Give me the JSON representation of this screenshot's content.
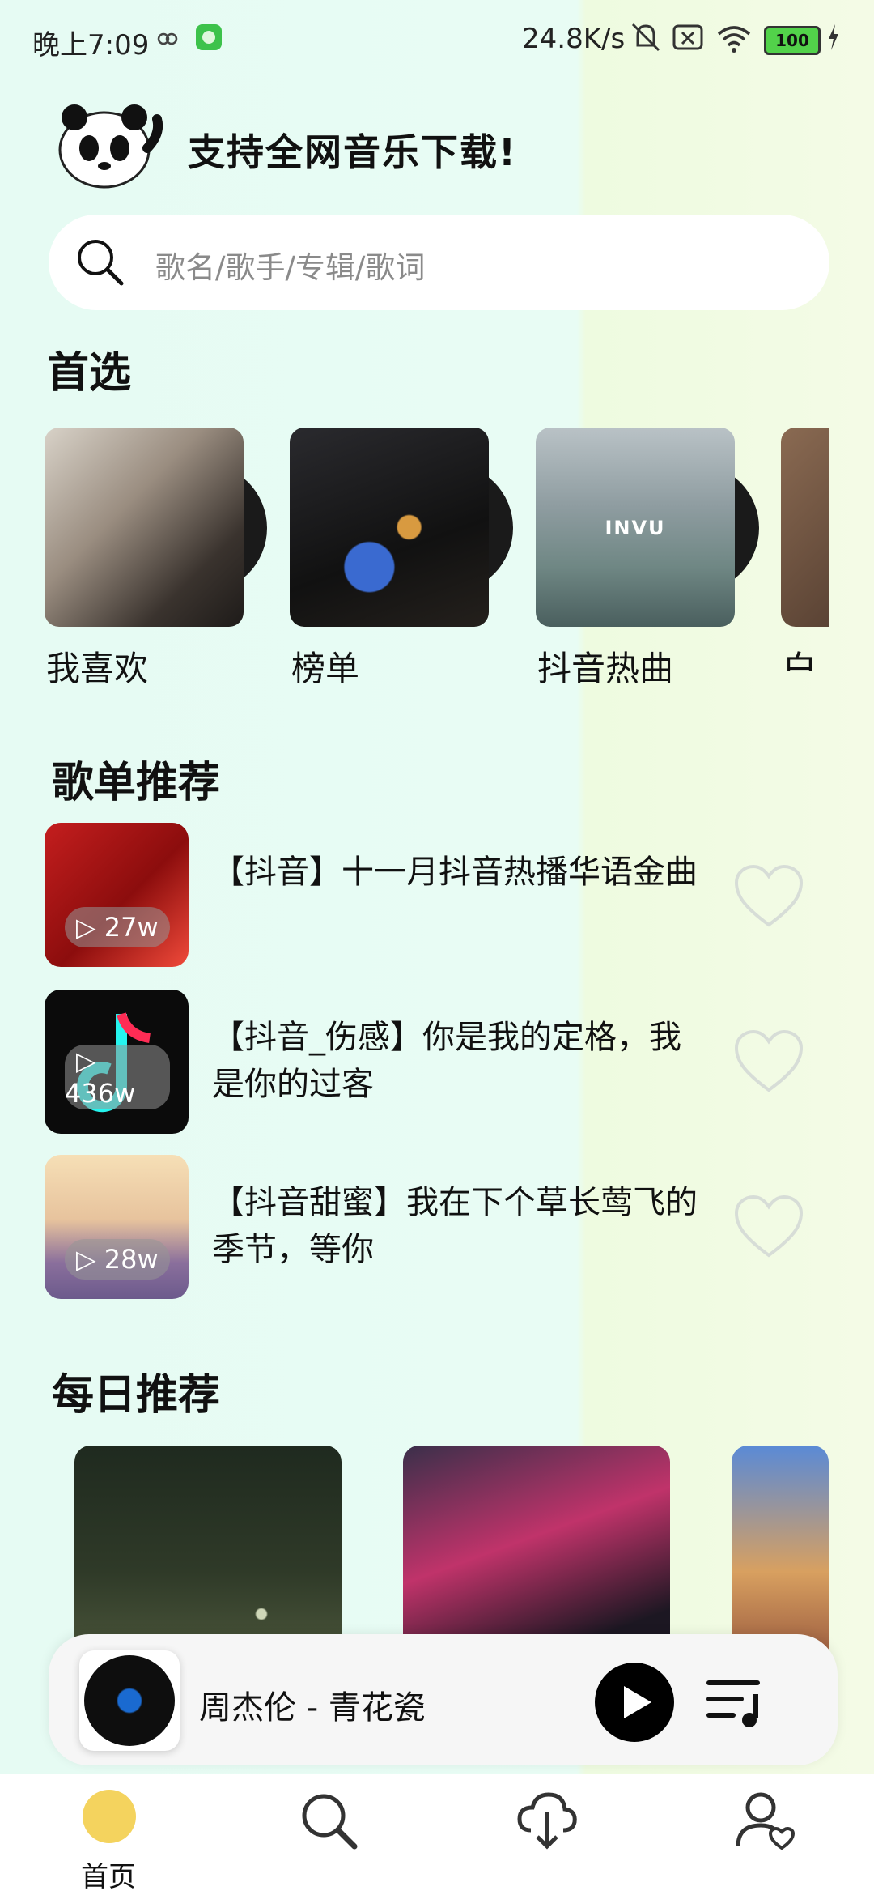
{
  "status_bar": {
    "time": "晚上7:09",
    "network_speed": "24.8K/s",
    "battery": "100",
    "icons": [
      "cloud-sync-icon",
      "app-badge-icon",
      "mute-bell-icon",
      "sim-x-icon",
      "wifi-icon",
      "battery-icon",
      "charging-icon"
    ]
  },
  "header": {
    "slogan": "支持全网音乐下载!"
  },
  "search": {
    "placeholder": "歌名/歌手/专辑/歌词"
  },
  "featured": {
    "title": "首选",
    "items": [
      {
        "label": "我喜欢"
      },
      {
        "label": "榜单"
      },
      {
        "label": "抖音热曲",
        "cover_text": "INVU"
      },
      {
        "label": "白"
      }
    ]
  },
  "playlists": {
    "title": "歌单推荐",
    "items": [
      {
        "title": "【抖音】十一月抖音热播华语金曲",
        "plays": "27w"
      },
      {
        "title": "【抖音_伤感】你是我的定格，我是你的过客",
        "plays": "436w"
      },
      {
        "title": "【抖音甜蜜】我在下个草长莺飞的季节，等你",
        "plays": "28w"
      }
    ]
  },
  "daily": {
    "title": "每日推荐"
  },
  "player": {
    "now_playing": "周杰伦 - 青花瓷"
  },
  "tabs": [
    {
      "label": "首页",
      "icon": "home-disc-icon",
      "active": true
    },
    {
      "label": "",
      "icon": "search-icon"
    },
    {
      "label": "",
      "icon": "cloud-download-icon"
    },
    {
      "label": "",
      "icon": "user-favorite-icon"
    }
  ],
  "colors": {
    "accent": "#f4d35e",
    "heart_outline": "#d7ddd7"
  }
}
